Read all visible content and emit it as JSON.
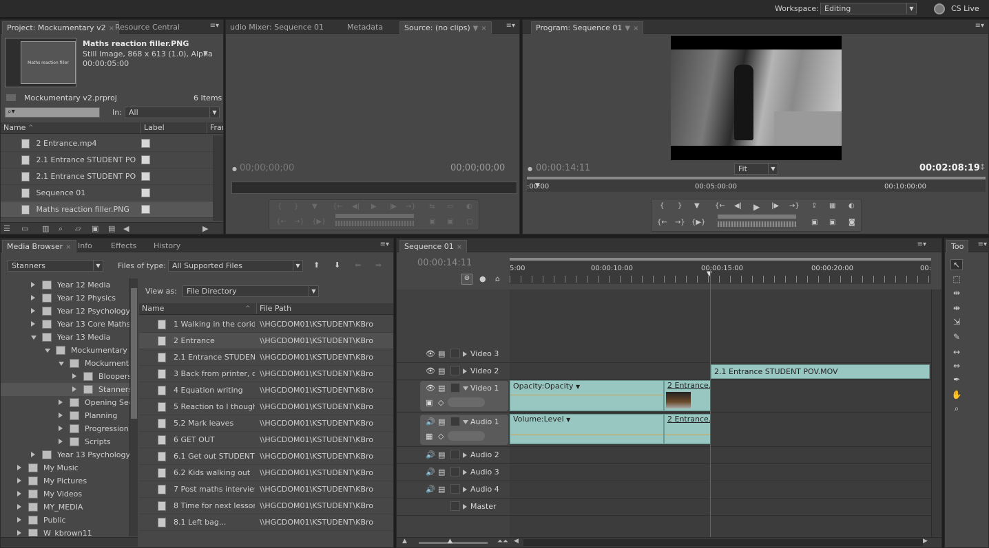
{
  "topbar": {
    "workspace_label": "Workspace:",
    "workspace_value": "Editing",
    "cs_live": "CS Live"
  },
  "project": {
    "tabs": [
      "Project: Mockumentary v2",
      "Resource Central"
    ],
    "clip_name": "Maths reaction filler.PNG",
    "clip_type": "Still Image, 868 x 613 (1.0), Alpha",
    "clip_duration": "00:00:05:00",
    "thumb_text": "Maths reaction filler",
    "project_file": "Mockumentary v2.prproj",
    "item_count": "6 Items",
    "in_label": "In:",
    "in_value": "All",
    "col_name": "Name",
    "col_label": "Label",
    "col_frame": "Fran",
    "items": [
      "2 Entrance.mp4",
      "2.1 Entrance STUDENT PO",
      "2.1 Entrance STUDENT PO",
      "Sequence 01",
      "Maths reaction filler.PNG"
    ]
  },
  "source": {
    "tabs": [
      "udio Mixer: Sequence 01",
      "Metadata",
      "Source: (no clips)"
    ],
    "timecode_in": "00;00;00;00",
    "timecode_out": "00;00;00;00"
  },
  "program": {
    "tab": "Program: Sequence 01",
    "timecode_current": "00:00:14:11",
    "fit": "Fit",
    "duration": "00:02:08:19",
    "ruler": [
      ":00:00",
      "00:05:00:00",
      "00:10:00:00"
    ]
  },
  "media_browser": {
    "tabs": [
      "Media Browser",
      "Info",
      "Effects",
      "History"
    ],
    "location": "Stanners",
    "files_of_type_label": "Files of type:",
    "files_of_type": "All Supported Files",
    "view_as_label": "View as:",
    "view_as": "File Directory",
    "col_name": "Name",
    "col_path": "File Path",
    "tree": [
      {
        "label": "Year 12 Media",
        "indent": 1,
        "open": false
      },
      {
        "label": "Year 12 Physics",
        "indent": 1,
        "open": false
      },
      {
        "label": "Year 12 Psychology",
        "indent": 1,
        "open": false
      },
      {
        "label": "Year 13 Core Maths",
        "indent": 1,
        "open": false
      },
      {
        "label": "Year 13 Media",
        "indent": 1,
        "open": true
      },
      {
        "label": "Mockumentary",
        "indent": 2,
        "open": true
      },
      {
        "label": "Mockumenta",
        "indent": 3,
        "open": true
      },
      {
        "label": "Bloopers",
        "indent": 4,
        "open": false
      },
      {
        "label": "Stanners",
        "indent": 4,
        "open": false
      },
      {
        "label": "Opening Seq",
        "indent": 3,
        "open": false
      },
      {
        "label": "Planning",
        "indent": 3,
        "open": false
      },
      {
        "label": "Progression",
        "indent": 3,
        "open": false
      },
      {
        "label": "Scripts",
        "indent": 3,
        "open": false
      },
      {
        "label": "Year 13 Psychology",
        "indent": 1,
        "open": false
      },
      {
        "label": "My Music",
        "indent": 0,
        "open": false
      },
      {
        "label": "My Pictures",
        "indent": 0,
        "open": false
      },
      {
        "label": "My Videos",
        "indent": 0,
        "open": false
      },
      {
        "label": "MY_MEDIA",
        "indent": 0,
        "open": false
      },
      {
        "label": "Public",
        "indent": 0,
        "open": false
      },
      {
        "label": "W_kbrown11",
        "indent": 0,
        "open": false
      }
    ],
    "files": [
      {
        "name": "1 Walking in the corido",
        "path": "\\\\HGCDOM01\\KSTUDENT\\KBro"
      },
      {
        "name": "2 Entrance",
        "path": "\\\\HGCDOM01\\KSTUDENT\\KBro"
      },
      {
        "name": "2.1 Entrance STUDENT",
        "path": "\\\\HGCDOM01\\KSTUDENT\\KBro"
      },
      {
        "name": "3 Back from printer, cal",
        "path": "\\\\HGCDOM01\\KSTUDENT\\KBro"
      },
      {
        "name": "4 Equation writing",
        "path": "\\\\HGCDOM01\\KSTUDENT\\KBro"
      },
      {
        "name": "5 Reaction to I thought",
        "path": "\\\\HGCDOM01\\KSTUDENT\\KBro"
      },
      {
        "name": "5.2 Mark leaves",
        "path": "\\\\HGCDOM01\\KSTUDENT\\KBro"
      },
      {
        "name": "6 GET OUT",
        "path": "\\\\HGCDOM01\\KSTUDENT\\KBro"
      },
      {
        "name": "6.1 Get out STUDENT P",
        "path": "\\\\HGCDOM01\\KSTUDENT\\KBro"
      },
      {
        "name": "6.2 Kids walking out",
        "path": "\\\\HGCDOM01\\KSTUDENT\\KBro"
      },
      {
        "name": "7 Post maths interview",
        "path": "\\\\HGCDOM01\\KSTUDENT\\KBro"
      },
      {
        "name": "8 Time for next lesson,",
        "path": "\\\\HGCDOM01\\KSTUDENT\\KBro"
      },
      {
        "name": "8.1 Left bag...",
        "path": "\\\\HGCDOM01\\KSTUDENT\\KBro"
      }
    ]
  },
  "timeline": {
    "tab": "Sequence 01",
    "timecode": "00:00:14:11",
    "ruler": [
      "5:00",
      "00:00:10:00",
      "00:00:15:00",
      "00:00:20:00",
      "00:"
    ],
    "tracks": {
      "video3": "Video 3",
      "video2": "Video 2",
      "video1": "Video 1",
      "audio1": "Audio 1",
      "audio2": "Audio 2",
      "audio3": "Audio 3",
      "audio4": "Audio 4",
      "master": "Master"
    },
    "clips": {
      "v2_clip": "2.1 Entrance STUDENT POV.MOV",
      "v1_opacity": "Opacity:Opacity",
      "v1_clip2": "2 Entrance.m",
      "a1_volume": "Volume:Level",
      "a1_clip2": "2 Entrance.m"
    }
  },
  "tools": {
    "tab": "Too"
  }
}
